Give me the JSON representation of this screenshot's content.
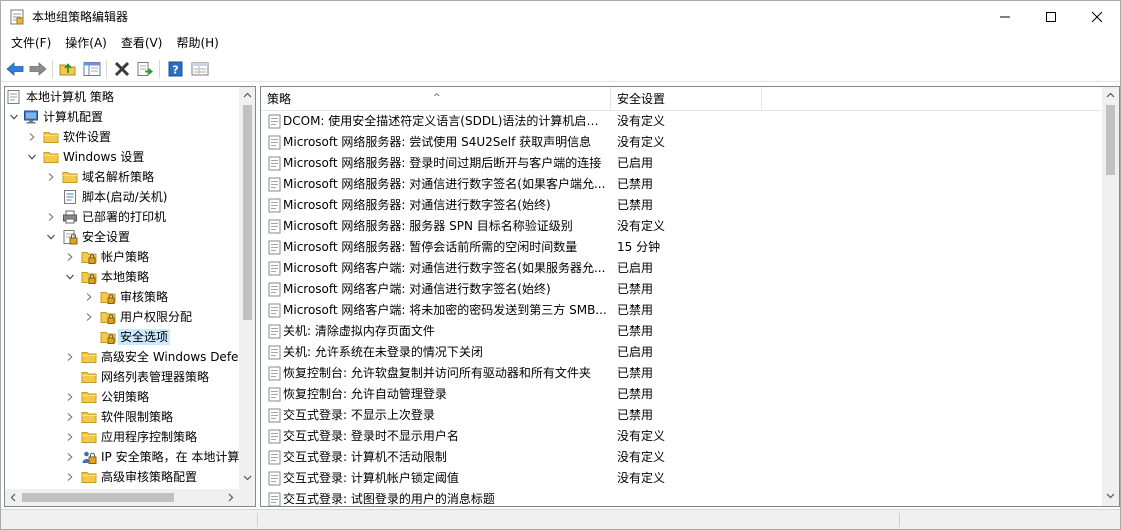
{
  "window": {
    "title": "本地组策略编辑器",
    "controls": [
      "minimize",
      "maximize",
      "close"
    ]
  },
  "menubar": [
    "文件(F)",
    "操作(A)",
    "查看(V)",
    "帮助(H)"
  ],
  "toolbar": [
    {
      "icon": "back-arrow-icon"
    },
    {
      "icon": "forward-arrow-icon"
    },
    {
      "icon": "up-folder-icon"
    },
    {
      "icon": "show-hide-tree-icon"
    },
    {
      "icon": "delete-icon"
    },
    {
      "icon": "export-list-icon"
    },
    {
      "icon": "help-icon"
    },
    {
      "icon": "properties-icon"
    }
  ],
  "tree": {
    "items": [
      {
        "label": "本地计算机 策略",
        "level": 0,
        "expander": "none",
        "icon": "policy-root-icon"
      },
      {
        "label": "计算机配置",
        "level": 0,
        "expander": "expanded",
        "icon": "computer-icon"
      },
      {
        "label": "软件设置",
        "level": 1,
        "expander": "collapsed",
        "icon": "folder-icon"
      },
      {
        "label": "Windows 设置",
        "level": 1,
        "expander": "expanded",
        "icon": "folder-icon"
      },
      {
        "label": "域名解析策略",
        "level": 2,
        "expander": "collapsed",
        "icon": "folder-icon"
      },
      {
        "label": "脚本(启动/关机)",
        "level": 2,
        "expander": "none",
        "icon": "script-icon"
      },
      {
        "label": "已部署的打印机",
        "level": 2,
        "expander": "collapsed",
        "icon": "printer-icon"
      },
      {
        "label": "安全设置",
        "level": 2,
        "expander": "expanded",
        "icon": "security-settings-icon"
      },
      {
        "label": "帐户策略",
        "level": 3,
        "expander": "collapsed",
        "icon": "locked-folder-icon"
      },
      {
        "label": "本地策略",
        "level": 3,
        "expander": "expanded",
        "icon": "locked-folder-icon"
      },
      {
        "label": "审核策略",
        "level": 4,
        "expander": "collapsed",
        "icon": "locked-folder-icon"
      },
      {
        "label": "用户权限分配",
        "level": 4,
        "expander": "collapsed",
        "icon": "locked-folder-icon"
      },
      {
        "label": "安全选项",
        "level": 4,
        "expander": "none",
        "icon": "locked-folder-icon",
        "selected": true
      },
      {
        "label": "高级安全 Windows Defe",
        "level": 3,
        "expander": "collapsed",
        "icon": "folder-icon"
      },
      {
        "label": "网络列表管理器策略",
        "level": 3,
        "expander": "none",
        "icon": "folder-icon"
      },
      {
        "label": "公钥策略",
        "level": 3,
        "expander": "collapsed",
        "icon": "folder-icon"
      },
      {
        "label": "软件限制策略",
        "level": 3,
        "expander": "collapsed",
        "icon": "folder-icon"
      },
      {
        "label": "应用程序控制策略",
        "level": 3,
        "expander": "collapsed",
        "icon": "folder-icon"
      },
      {
        "label": "IP 安全策略，在 本地计算",
        "level": 3,
        "expander": "collapsed",
        "icon": "ip-security-icon"
      },
      {
        "label": "高级审核策略配置",
        "level": 3,
        "expander": "collapsed",
        "icon": "folder-icon"
      }
    ]
  },
  "list": {
    "columns": [
      "策略",
      "安全设置"
    ],
    "rows": [
      {
        "policy": "DCOM: 使用安全描述符定义语言(SDDL)语法的计算机启动...",
        "setting": "没有定义"
      },
      {
        "policy": "Microsoft 网络服务器: 尝试使用 S4U2Self 获取声明信息",
        "setting": "没有定义"
      },
      {
        "policy": "Microsoft 网络服务器: 登录时间过期后断开与客户端的连接",
        "setting": "已启用"
      },
      {
        "policy": "Microsoft 网络服务器: 对通信进行数字签名(如果客户端允...",
        "setting": "已禁用"
      },
      {
        "policy": "Microsoft 网络服务器: 对通信进行数字签名(始终)",
        "setting": "已禁用"
      },
      {
        "policy": "Microsoft 网络服务器: 服务器 SPN 目标名称验证级别",
        "setting": "没有定义"
      },
      {
        "policy": "Microsoft 网络服务器: 暂停会话前所需的空闲时间数量",
        "setting": "15 分钟"
      },
      {
        "policy": "Microsoft 网络客户端: 对通信进行数字签名(如果服务器允...",
        "setting": "已启用"
      },
      {
        "policy": "Microsoft 网络客户端: 对通信进行数字签名(始终)",
        "setting": "已禁用"
      },
      {
        "policy": "Microsoft 网络客户端: 将未加密的密码发送到第三方 SMB...",
        "setting": "已禁用"
      },
      {
        "policy": "关机: 清除虚拟内存页面文件",
        "setting": "已禁用"
      },
      {
        "policy": "关机: 允许系统在未登录的情况下关闭",
        "setting": "已启用"
      },
      {
        "policy": "恢复控制台: 允许软盘复制并访问所有驱动器和所有文件夹",
        "setting": "已禁用"
      },
      {
        "policy": "恢复控制台: 允许自动管理登录",
        "setting": "已禁用"
      },
      {
        "policy": "交互式登录: 不显示上次登录",
        "setting": "已禁用"
      },
      {
        "policy": "交互式登录: 登录时不显示用户名",
        "setting": "没有定义"
      },
      {
        "policy": "交互式登录: 计算机不活动限制",
        "setting": "没有定义"
      },
      {
        "policy": "交互式登录: 计算机帐户锁定阈值",
        "setting": "没有定义"
      },
      {
        "policy": "交互式登录: 试图登录的用户的消息标题",
        "setting": ""
      }
    ]
  },
  "colors": {
    "selection": "#cce8ff",
    "folder": "#f4c848",
    "help": "#2b6cc4"
  }
}
